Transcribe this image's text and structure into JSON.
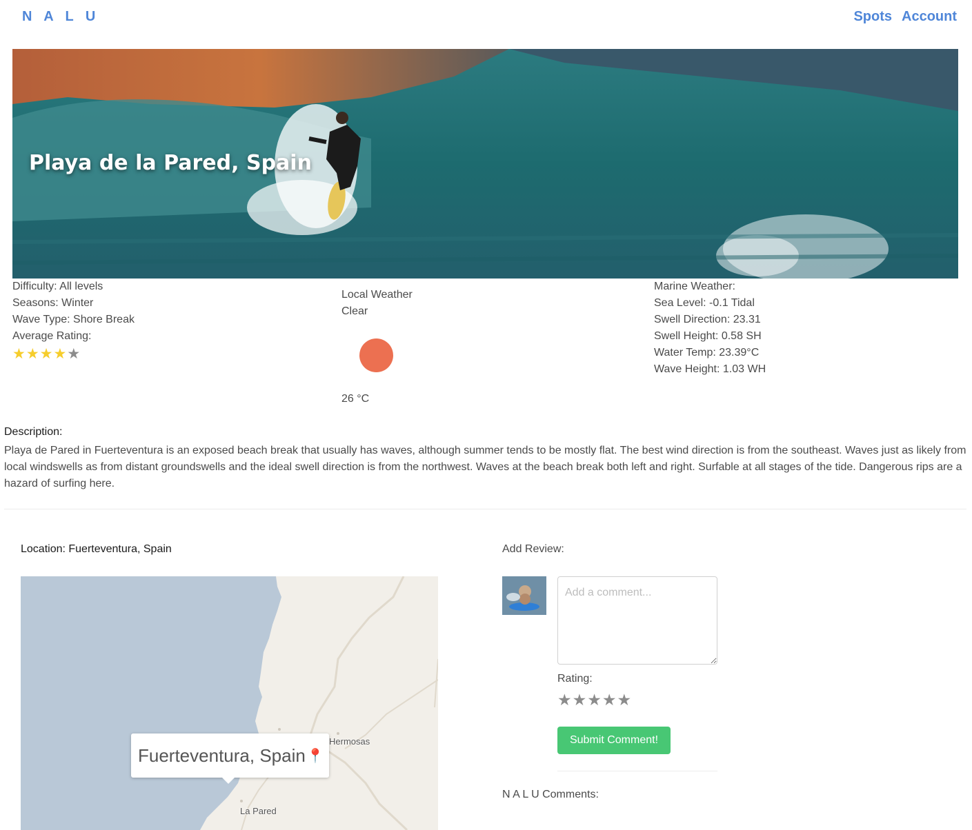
{
  "nav": {
    "brand": "N A L U",
    "links": [
      "Spots",
      "Account"
    ]
  },
  "hero": {
    "title": "Playa de la Pared, Spain"
  },
  "details": {
    "difficulty": "Difficulty: All levels",
    "seasons": "Seasons: Winter",
    "wave_type": "Wave Type: Shore Break",
    "average_rating_label": "Average Rating:",
    "average_rating": 4,
    "max_rating": 5
  },
  "local_weather": {
    "title": "Local Weather",
    "condition": "Clear",
    "icon": "sun-icon",
    "temperature": "26 °C"
  },
  "marine_weather": {
    "title": "Marine Weather:",
    "sea_level": "Sea Level: -0.1 Tidal",
    "swell_direction": "Swell Direction: 23.31",
    "swell_height": "Swell Height: 0.58 SH",
    "water_temp": "Water Temp: 23.39°C",
    "wave_height": "Wave Height: 1.03 WH"
  },
  "description": {
    "label": "Description:",
    "text": "Playa de Pared in Fuerteventura is an exposed beach break that usually has waves, although summer tends to be mostly flat. The best wind direction is from the southeast. Waves just as likely from local windswells as from distant groundswells and the ideal swell direction is from the northwest. Waves at the beach break both left and right. Surfable at all stages of the tide. Dangerous rips are a hazard of surfing here."
  },
  "location": {
    "label": "Location: Fuerteventura, Spain",
    "popup": "Fuerteventura, Spain",
    "place_labels": [
      "Hermosas",
      "La Pared"
    ]
  },
  "review": {
    "label": "Add Review:",
    "placeholder": "Add a comment...",
    "rating_label": "Rating:",
    "rating_value": 0,
    "submit_label": "Submit Comment!"
  },
  "comments": {
    "label": "N A L U Comments:"
  },
  "colors": {
    "brand": "#4f86d8",
    "submit": "#48c774",
    "star_on": "#f6cd2c",
    "star_off": "#8c8c8c",
    "sun": "#ec7051",
    "sea": "#b9c8d7",
    "land": "#f2efe9"
  }
}
